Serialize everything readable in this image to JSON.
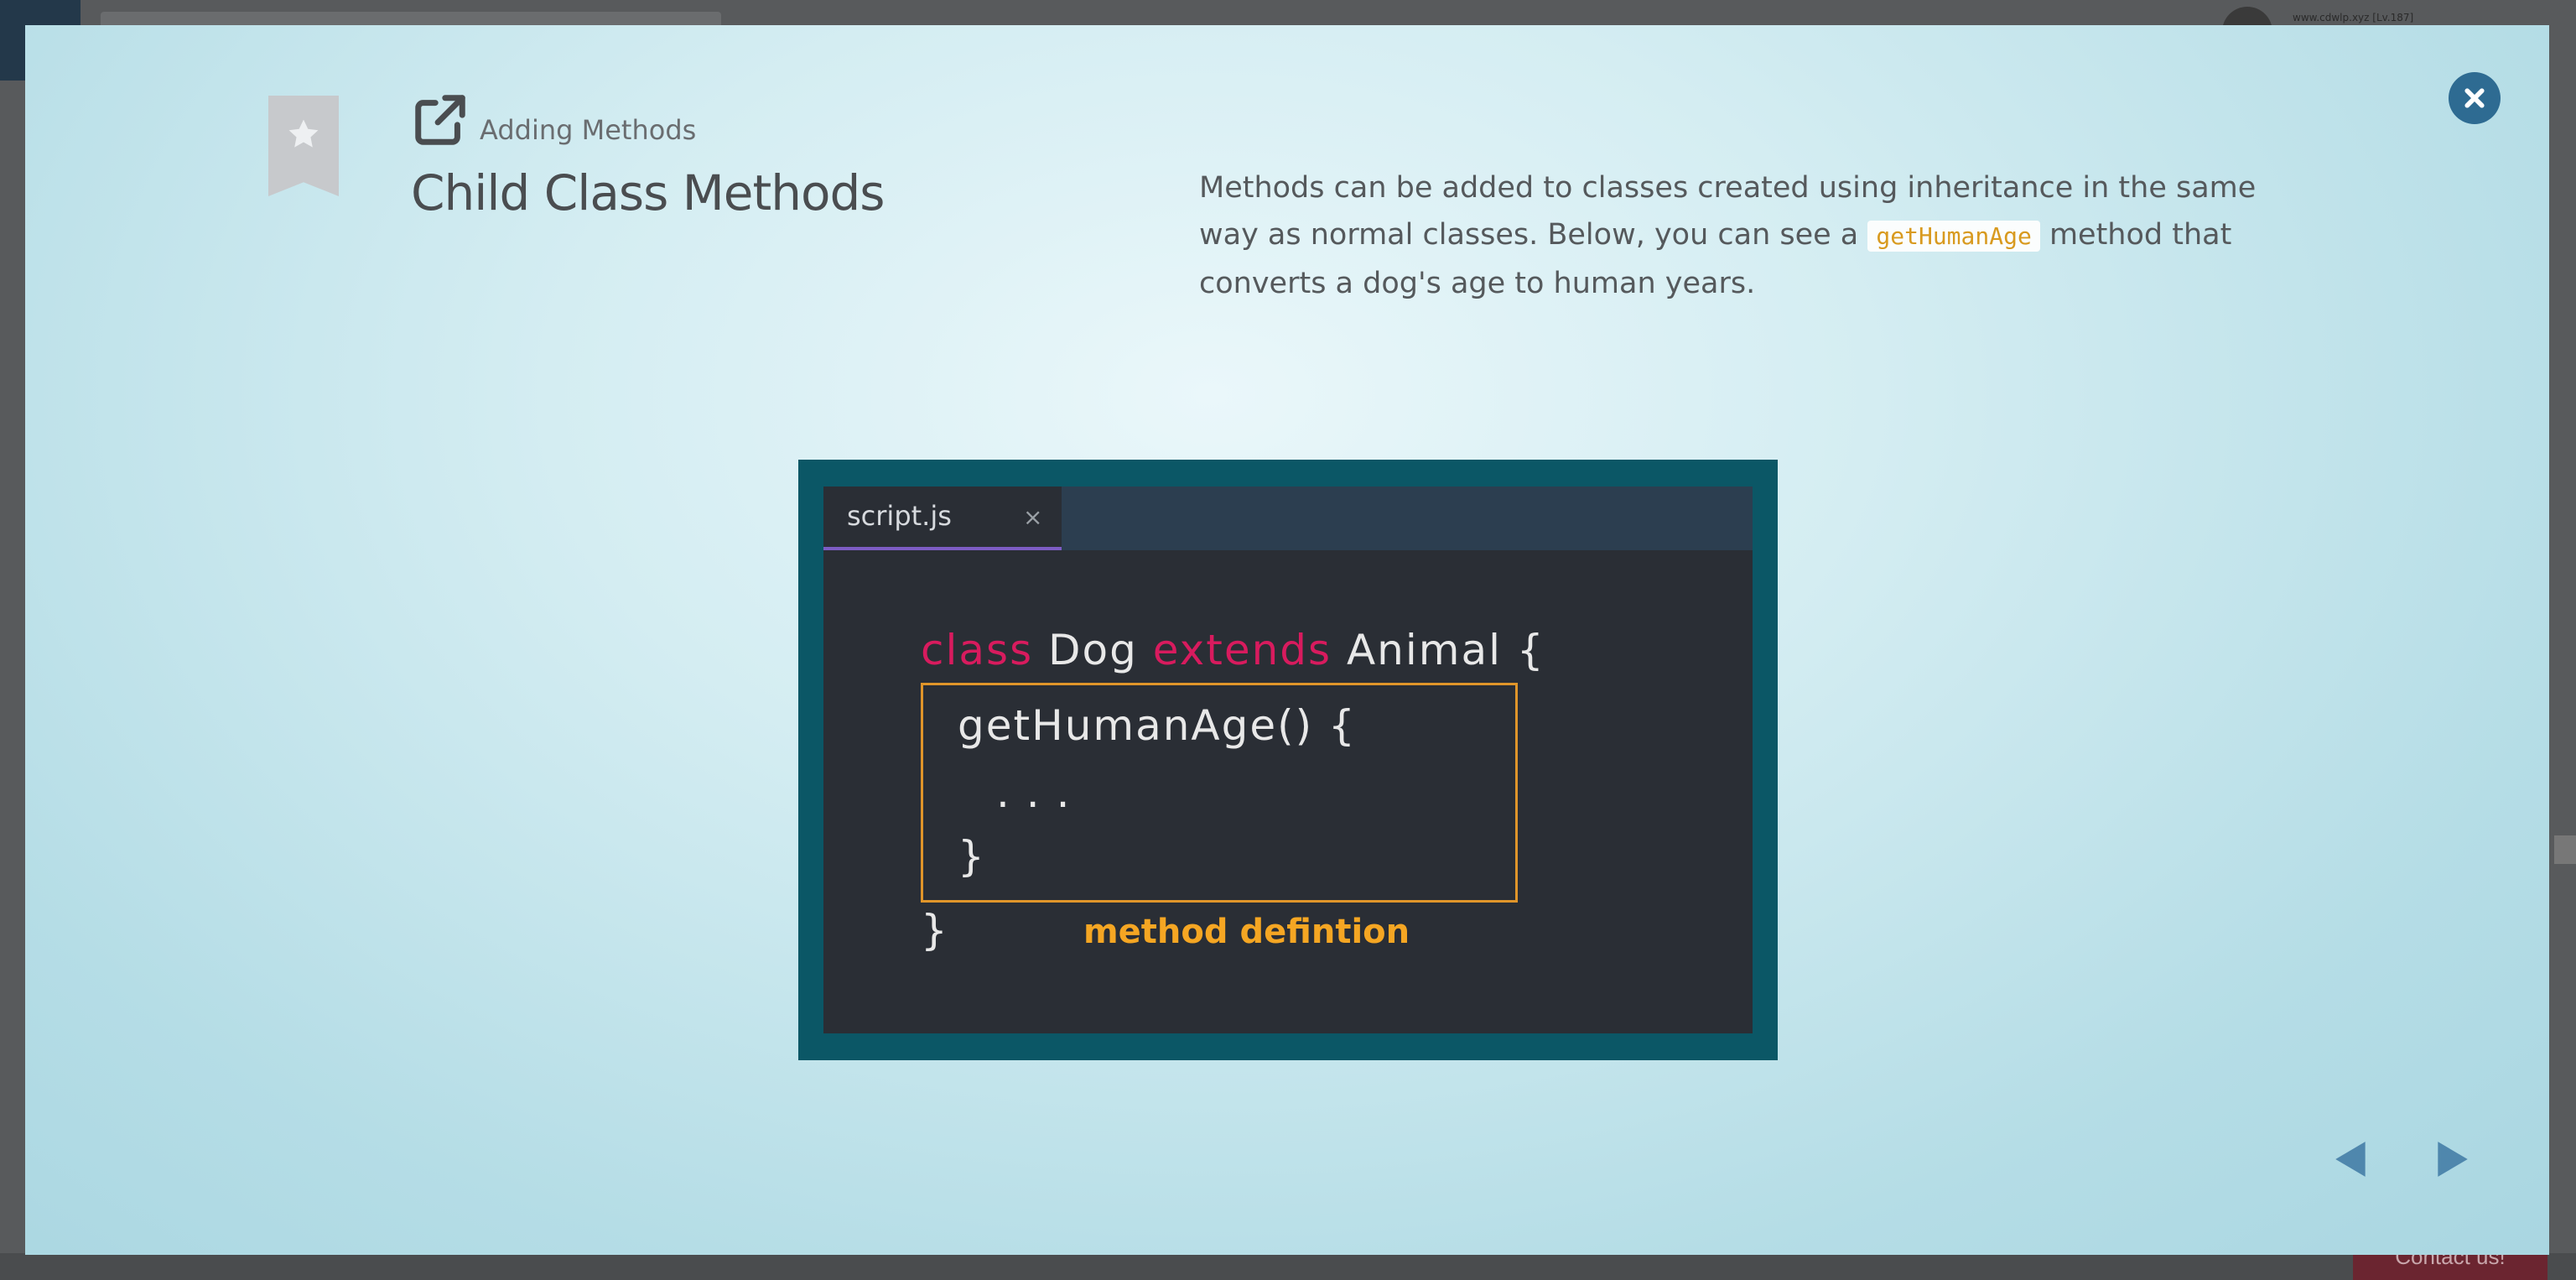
{
  "background": {
    "user_label": "www.cdwlp.xyz [Lv.187]",
    "contact_label": "Contact us!"
  },
  "slide": {
    "kicker": "Adding Methods",
    "title": "Child Class Methods",
    "description_before": "Methods can be added to classes created using inheritance in the same way as normal classes. Below, you can see a ",
    "description_code": "getHumanAge",
    "description_after": " method that converts a dog's age to human years."
  },
  "code_image": {
    "tab_label": "script.js",
    "tab_close": "×",
    "line1_kw1": "class",
    "line1_name": " Dog ",
    "line1_kw2": "extends",
    "line1_rest": " Animal {",
    "line2": "getHumanAge() {",
    "line3": ". . .",
    "line4": "}",
    "line5": "}",
    "annotation": "method defintion"
  },
  "colors": {
    "accent": "#2e6b92",
    "keyword": "#d81b5e",
    "annotation": "#f5a623"
  },
  "icons": {
    "bookmark": "bookmark-star-icon",
    "external": "external-link-icon",
    "close": "close-icon",
    "prev": "arrow-left-icon",
    "next": "arrow-right-icon"
  }
}
